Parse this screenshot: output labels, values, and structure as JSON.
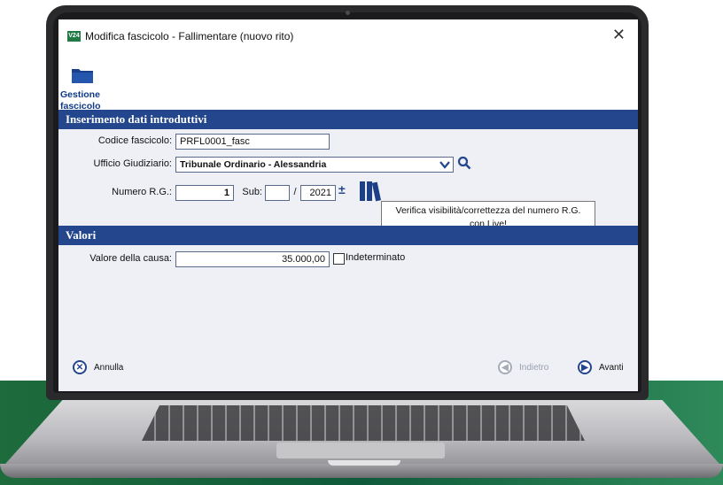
{
  "window": {
    "title": "Modifica fascicolo - Fallimentare (nuovo rito)",
    "app_icon_text": "V24",
    "close_label": "✕"
  },
  "toolbar": {
    "gestione_label": "Gestione fascicolo"
  },
  "sections": {
    "intro": "Inserimento dati introduttivi",
    "valori": "Valori"
  },
  "fields": {
    "codice_label": "Codice fascicolo:",
    "codice_value": "PRFL0001_fasc",
    "ufficio_label": "Ufficio Giudiziario:",
    "ufficio_value": "Tribunale Ordinario - Alessandria",
    "numero_label": "Numero R.G.:",
    "numero_value": "1",
    "sub_label": "Sub:",
    "sub_value": "",
    "slash": "/",
    "anno_value": "2021",
    "plusminus": "±",
    "valore_label": "Valore della causa:",
    "valore_value": "35.000,00",
    "indeterminato_label": "Indeterminato"
  },
  "tooltip": {
    "line1": "Verifica visibilità/correttezza del numero R.G.",
    "line2": "con Live!"
  },
  "buttons": {
    "annulla": "Annulla",
    "indietro": "Indietro",
    "avanti": "Avanti"
  },
  "colors": {
    "header_blue": "#23468d",
    "label_blue": "#0d3a86",
    "brand_green": "#1f7a44"
  }
}
